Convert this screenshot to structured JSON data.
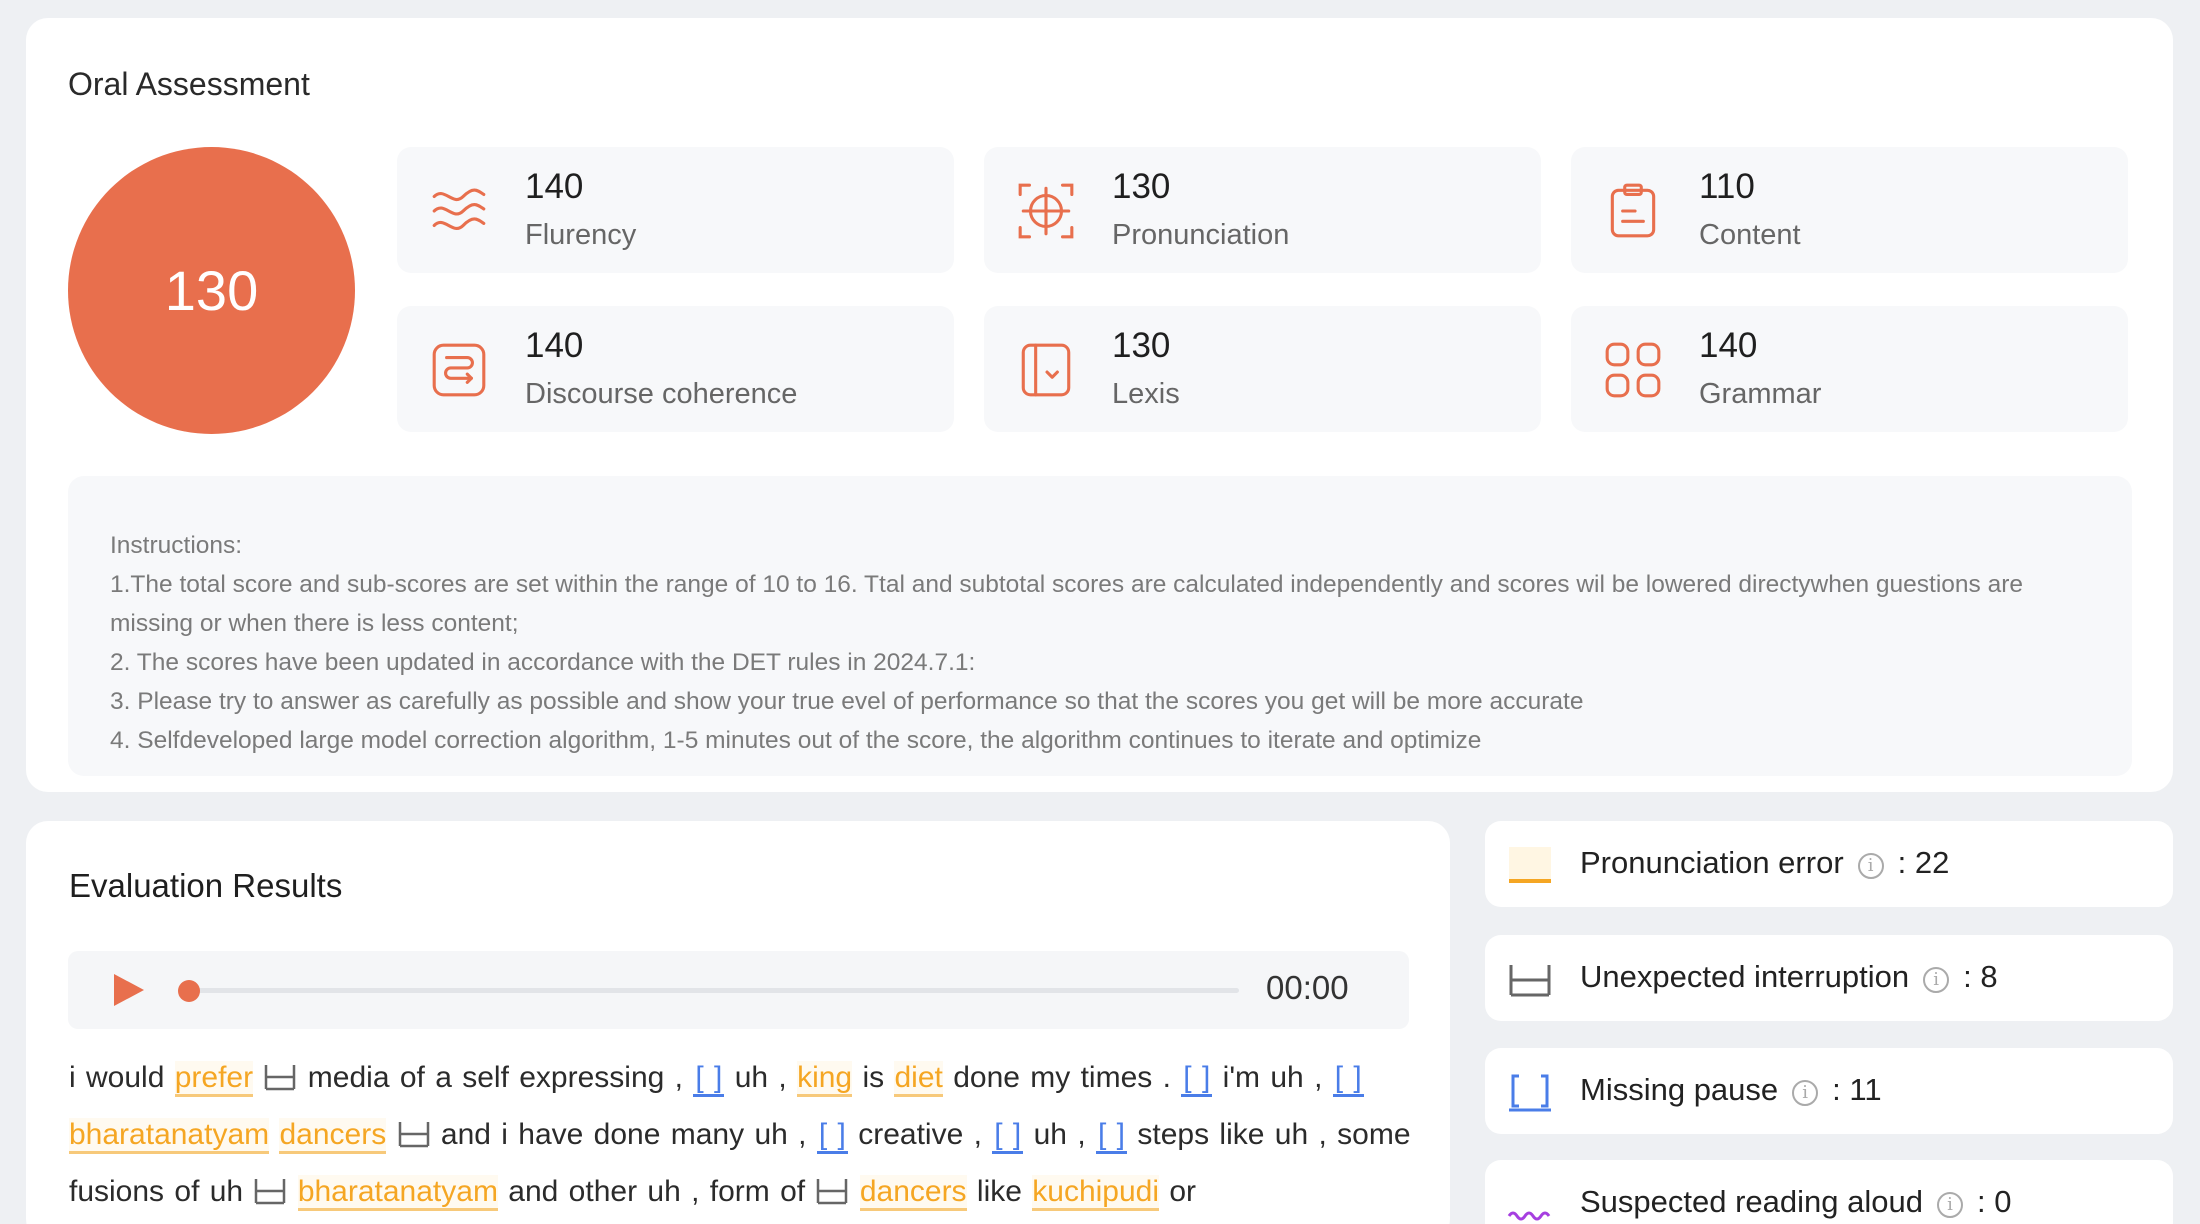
{
  "header": {
    "title": "Oral Assessment"
  },
  "total_score": "130",
  "metrics": [
    {
      "value": "140",
      "label": "Flurency",
      "icon": "waves-icon"
    },
    {
      "value": "130",
      "label": "Pronunciation",
      "icon": "crosshair-icon"
    },
    {
      "value": "110",
      "label": "Content",
      "icon": "clipboard-icon"
    },
    {
      "value": "140",
      "label": "Discourse coherence",
      "icon": "flow-icon"
    },
    {
      "value": "130",
      "label": "Lexis",
      "icon": "book-icon"
    },
    {
      "value": "140",
      "label": "Grammar",
      "icon": "grid-icon"
    }
  ],
  "instructions": {
    "heading": "Instructions:",
    "lines": [
      "1.The total score and sub-scores are set within the range of 10 to 16. Ttal and subtotal scores are calculated independently and scores wil be lowered directywhen guestions are missing or when there is less content;",
      "2. The scores have been updated in accordance with the DET rules in 2024.7.1:",
      "3. Please try to answer as carefully as possible and show your true evel of performance so that the scores you get will be more accurate",
      "4. Selfdeveloped large model correction algorithm, 1-5 minutes out of the score, the algorithm continues to iterate and optimize"
    ]
  },
  "evaluation": {
    "title": "Evaluation Results",
    "player": {
      "time": "00:00",
      "progress": 0
    },
    "transcript": [
      {
        "t": "text",
        "v": "i would"
      },
      {
        "t": "pe",
        "v": "prefer"
      },
      {
        "t": "ui"
      },
      {
        "t": "text",
        "v": "media of a self expressing ,"
      },
      {
        "t": "mp",
        "v": "[ ]"
      },
      {
        "t": "text",
        "v": "uh ,"
      },
      {
        "t": "pe",
        "v": "king"
      },
      {
        "t": "text",
        "v": "is"
      },
      {
        "t": "pe",
        "v": "diet"
      },
      {
        "t": "text",
        "v": "done my times ."
      },
      {
        "t": "mp",
        "v": "[ ]"
      },
      {
        "t": "text",
        "v": "i'm uh ,"
      },
      {
        "t": "mp",
        "v": "[ ]"
      },
      {
        "t": "pe",
        "v": "bharatanatyam"
      },
      {
        "t": "pe",
        "v": "dancers"
      },
      {
        "t": "ui"
      },
      {
        "t": "text",
        "v": "and i have done many uh ,"
      },
      {
        "t": "mp",
        "v": "[ ]"
      },
      {
        "t": "text",
        "v": "creative ,"
      },
      {
        "t": "mp",
        "v": "[ ]"
      },
      {
        "t": "text",
        "v": "uh ,"
      },
      {
        "t": "mp",
        "v": "[ ]"
      },
      {
        "t": "text",
        "v": "steps like uh , some fusions of uh"
      },
      {
        "t": "ui"
      },
      {
        "t": "pe",
        "v": "bharatanatyam"
      },
      {
        "t": "text",
        "v": "and other uh , form of"
      },
      {
        "t": "ui"
      },
      {
        "t": "pe",
        "v": "dancers"
      },
      {
        "t": "text",
        "v": "like"
      },
      {
        "t": "pe",
        "v": "kuchipudi"
      },
      {
        "t": "text",
        "v": "or"
      }
    ]
  },
  "legend": [
    {
      "label": "Pronunciation error",
      "count": ": 22",
      "icon": "pronunciation-error-swatch-icon"
    },
    {
      "label": "Unexpected interruption",
      "count": ": 8",
      "icon": "interruption-icon"
    },
    {
      "label": "Missing pause",
      "count": ": 11",
      "icon": "missing-pause-icon"
    },
    {
      "label": "Suspected reading aloud",
      "count": ": 0",
      "icon": "wavy-line-icon"
    }
  ],
  "colors": {
    "accent": "#e86f4d",
    "pronunciation_error": "#f5a623",
    "missing_pause": "#4a7de8",
    "reading_aloud": "#a63fe0"
  }
}
